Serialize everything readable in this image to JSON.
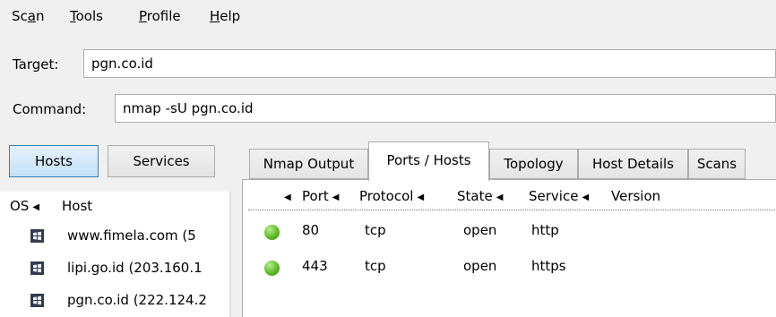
{
  "menubar": {
    "items": [
      {
        "pre": "Sc",
        "mn": "a",
        "post": "n"
      },
      {
        "pre": "",
        "mn": "T",
        "post": "ools"
      },
      {
        "pre": "",
        "mn": "P",
        "post": "rofile"
      },
      {
        "pre": "",
        "mn": "H",
        "post": "elp"
      }
    ]
  },
  "target": {
    "label": "Target:",
    "value": "pgn.co.id"
  },
  "command": {
    "label": "Command:",
    "value": "nmap -sU pgn.co.id"
  },
  "side_buttons": {
    "hosts": "Hosts",
    "services": "Services"
  },
  "hosts_list": {
    "header": {
      "os": "OS",
      "host": "Host"
    },
    "rows": [
      {
        "host": "www.fimela.com (5"
      },
      {
        "host": "lipi.go.id (203.160.1"
      },
      {
        "host": "pgn.co.id (222.124.2"
      }
    ]
  },
  "tabs": [
    {
      "label": "Nmap Output"
    },
    {
      "label": "Ports / Hosts"
    },
    {
      "label": "Topology"
    },
    {
      "label": "Host Details"
    },
    {
      "label": "Scans"
    }
  ],
  "active_tab": "Ports / Hosts",
  "ports_table": {
    "headers": {
      "port": "Port",
      "protocol": "Protocol",
      "state": "State",
      "service": "Service",
      "version": "Version"
    },
    "rows": [
      {
        "port": "80",
        "protocol": "tcp",
        "state": "open",
        "service": "http",
        "version": ""
      },
      {
        "port": "443",
        "protocol": "tcp",
        "state": "open",
        "service": "https",
        "version": ""
      }
    ]
  },
  "colors": {
    "open_status": "#5fb92a",
    "active_button": "#c4e0f7"
  },
  "icons": {
    "os": "windows-os-icon",
    "status": "open-status-dot-icon",
    "sort": "sort-triangle-icon"
  }
}
